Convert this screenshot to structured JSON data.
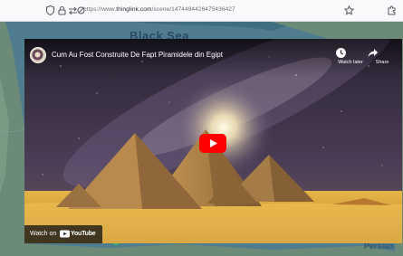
{
  "browser": {
    "url_prefix": "https://www.",
    "url_domain": "thinglink.com",
    "url_path": "/scene/1474494426475436427"
  },
  "map": {
    "sea_label": "Black Sea",
    "corner_label": "Persian",
    "colors": {
      "water": "#4f7c8e",
      "land": "#6b8a78"
    }
  },
  "video": {
    "title": "Cum Au Fost Construite De Fapt Piramidele din Egipt",
    "watch_later_label": "Watch later",
    "share_label": "Share",
    "watch_on_label": "Watch on",
    "platform_label": "YouTube",
    "colors": {
      "play_button": "#ff0000",
      "sand": "#d4a236",
      "sky": "#2d2436"
    }
  }
}
